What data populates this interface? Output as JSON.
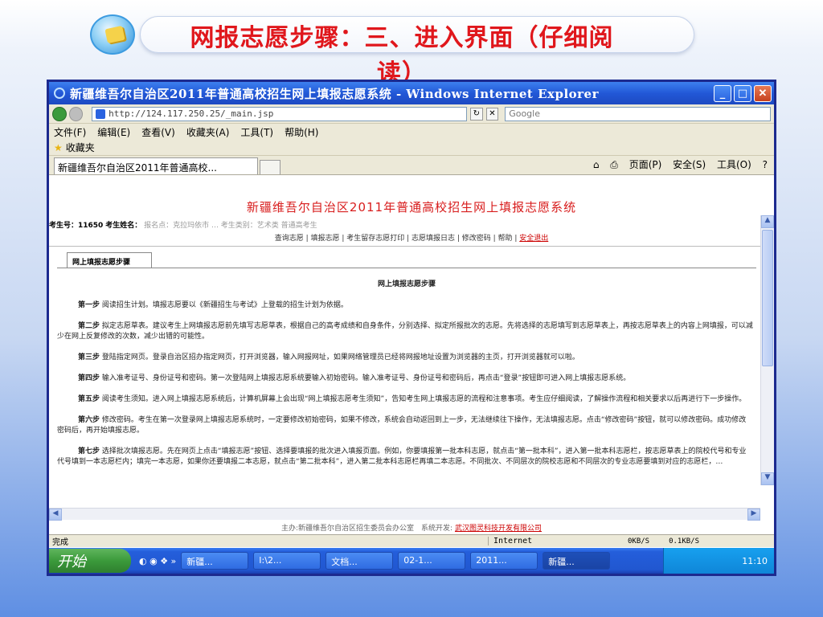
{
  "slide": {
    "title": "网报志愿步骤：三、进入界面（仔细阅读）"
  },
  "window": {
    "title": "新疆维吾尔自治区2011年普通高校招生网上填报志愿系统 - Windows Internet Explorer",
    "minimize": "_",
    "maximize": "□",
    "close": "✕"
  },
  "addressbar": {
    "url": "http://124.117.250.25/_main.jsp",
    "search_placeholder": "Google"
  },
  "menu": [
    "文件(F)",
    "编辑(E)",
    "查看(V)",
    "收藏夹(A)",
    "工具(T)",
    "帮助(H)"
  ],
  "favorites": {
    "label": "收藏夹"
  },
  "tab": {
    "label": "新疆维吾尔自治区2011年普通高校..."
  },
  "commandbar": {
    "page": "页面(P)",
    "safety": "安全(S)",
    "tools": "工具(O)"
  },
  "page": {
    "system_title": "新疆维吾尔自治区2011年普通高校招生网上填报志愿系统",
    "info_exam_no_label": "考生号：11650",
    "info_name_label": "考生姓名：",
    "info_grey": "报名点：克拉玛依市 … 考生类别：艺术类 普通高考生",
    "nav_links": "查询志愿 | 填报志愿 | 考生留存志愿打印 | 志愿填报日志 | 修改密码 | 帮助 | ",
    "nav_logout": "安全退出",
    "proc_tab": "网上填报志愿步骤",
    "proc_heading": "网上填报志愿步骤",
    "steps": [
      {
        "label": "第一步",
        "text": "阅读招生计划。填报志愿要以《新疆招生与考试》上登载的招生计划为依据。"
      },
      {
        "label": "第二步",
        "text": "拟定志愿草表。建议考生上网填报志愿前先填写志愿草表，根据自己的高考成绩和自身条件，分别选择、拟定所报批次的志愿。先将选择的志愿填写到志愿草表上，再按志愿草表上的内容上网填报，可以减少在网上反复修改的次数，减少出错的可能性。"
      },
      {
        "label": "第三步",
        "text": "登陆指定网页。登录自治区招办指定网页，打开浏览器，输入网报网址，如果网络管理员已经将网报地址设置为浏览器的主页，打开浏览器就可以啦。"
      },
      {
        "label": "第四步",
        "text": "输入准考证号、身份证号和密码。第一次登陆网上填报志愿系统要输入初始密码。输入准考证号、身份证号和密码后，再点击“登录”按钮即可进入网上填报志愿系统。"
      },
      {
        "label": "第五步",
        "text": "阅读考生须知。进入网上填报志愿系统后，计算机屏幕上会出现“网上填报志愿考生须知”，告知考生网上填报志愿的流程和注意事项。考生应仔细阅读，了解操作流程和相关要求以后再进行下一步操作。"
      },
      {
        "label": "第六步",
        "text": "修改密码。考生在第一次登录网上填报志愿系统时，一定要修改初始密码，如果不修改，系统会自动返回到上一步，无法继续往下操作，无法填报志愿。点击“修改密码”按钮，就可以修改密码。成功修改密码后，再开始填报志愿。"
      },
      {
        "label": "第七步",
        "text": "选择批次填报志愿。先在网页上点击“填报志愿”按钮、选择要填报的批次进入填报页面。例如，你要填报第一批本科志愿，就点击“第一批本科”，进入第一批本科志愿栏，按志愿草表上的院校代号和专业代号填到一本志愿栏内；填完一本志愿，如果你还要填报二本志愿，就点击“第二批本科”，进入第二批本科志愿栏再填二本志愿。不同批次、不同层次的院校志愿和不同层次的专业志愿要填到对应的志愿栏，…"
      }
    ],
    "footer_text": "主办:新疆维吾尔自治区招生委员会办公室　系统开发:",
    "footer_link": "武汉图灵科技开发有限公司"
  },
  "statusbar": {
    "left": "完成",
    "zone": "Internet",
    "down_speed": "0KB/S",
    "up_speed": "0.1KB/S"
  },
  "taskbar": {
    "start": "开始",
    "tasks": [
      "新疆...",
      "I:\\2...",
      "文档...",
      "02-1...",
      "2011...",
      "新疆..."
    ],
    "clock": "11:10"
  }
}
